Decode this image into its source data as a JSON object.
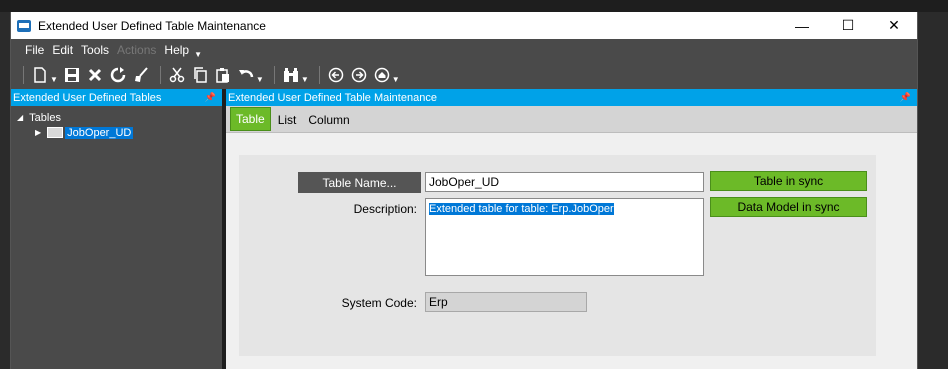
{
  "window": {
    "title": "Extended User Defined Table Maintenance",
    "controls": {
      "minimize": "—",
      "maximize": "☐",
      "close": "✕"
    }
  },
  "menubar": {
    "items": [
      {
        "label": "File",
        "enabled": true
      },
      {
        "label": "Edit",
        "enabled": true
      },
      {
        "label": "Tools",
        "enabled": true
      },
      {
        "label": "Actions",
        "enabled": false
      },
      {
        "label": "Help",
        "enabled": true
      }
    ]
  },
  "toolbar": {
    "icons": [
      "new-icon",
      "save-icon",
      "delete-icon",
      "refresh-icon",
      "clear-icon",
      "cut-icon",
      "copy-icon",
      "paste-icon",
      "undo-icon",
      "search-icon",
      "back-icon",
      "forward-icon",
      "home-icon"
    ]
  },
  "left_panel": {
    "header": "Extended User Defined Tables",
    "tree": {
      "root_label": "Tables",
      "children": [
        {
          "label": "JobOper_UD",
          "selected": true
        }
      ]
    }
  },
  "right_panel": {
    "header": "Extended User Defined Table Maintenance",
    "tabs": [
      {
        "label": "Table",
        "active": true
      },
      {
        "label": "List",
        "active": false
      },
      {
        "label": "Column",
        "active": false
      }
    ],
    "form": {
      "table_name_button": "Table Name...",
      "table_name_value": "JobOper_UD",
      "description_label": "Description:",
      "description_value": "Extended table for table: Erp.JobOper",
      "system_code_label": "System Code:",
      "system_code_value": "Erp",
      "status_table": "Table in sync",
      "status_model": "Data Model in sync"
    }
  },
  "colors": {
    "accent_blue": "#00a2e8",
    "sync_green": "#6cba28",
    "dark_chrome": "#4a4a4a"
  }
}
